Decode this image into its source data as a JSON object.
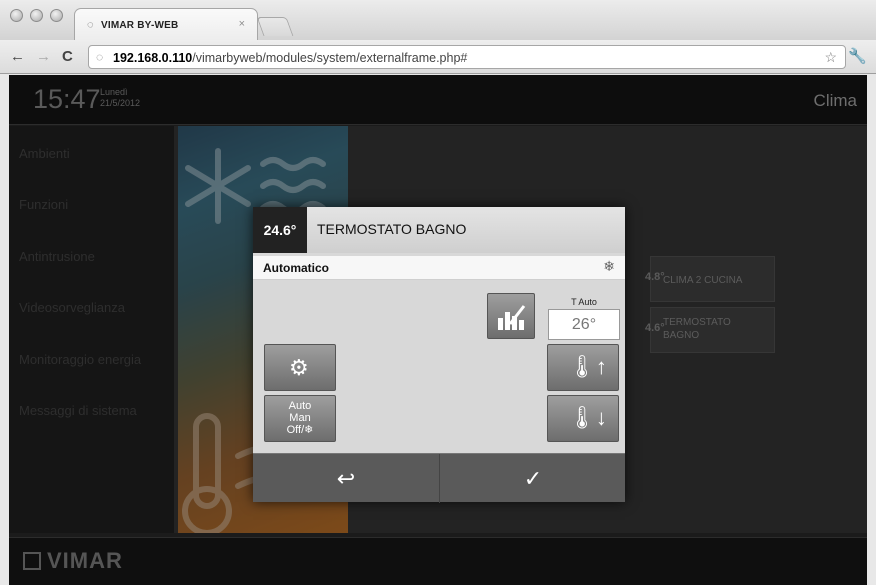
{
  "browser": {
    "tab_title": "VIMAR BY-WEB",
    "tab_close": "×",
    "url_host": "192.168.0.110",
    "url_path": "/vimarbyweb/modules/system/externalframe.php#",
    "icons": [
      "back-icon",
      "forward-icon",
      "reload-icon",
      "star-icon",
      "wrench-icon"
    ]
  },
  "header": {
    "time": "15:47",
    "day": "Lunedì",
    "date": "21/5/2012",
    "section": "Clima"
  },
  "sidebar": {
    "items": [
      {
        "label": "Ambienti"
      },
      {
        "label": "Funzioni"
      },
      {
        "label": "Antintrusione"
      },
      {
        "label": "Videosorveglianza"
      },
      {
        "label": "Monitoraggio energia"
      },
      {
        "label": "Messaggi di sistema"
      }
    ]
  },
  "background_cards": [
    {
      "temp": "4.8°",
      "label": "CLIMA 2 CUCINA"
    },
    {
      "temp": "4.6°",
      "label": "TERMOSTATO BAGNO"
    }
  ],
  "dialog": {
    "temperature": "24.6°",
    "title": "TERMOSTATO BAGNO",
    "mode": "Automatico",
    "t_auto_label": "T Auto",
    "t_auto_value": "26°",
    "mode_button": {
      "line1": "Auto",
      "line2": "Man",
      "line3": "Off/"
    }
  },
  "footer": {
    "logo": "VIMAR"
  }
}
